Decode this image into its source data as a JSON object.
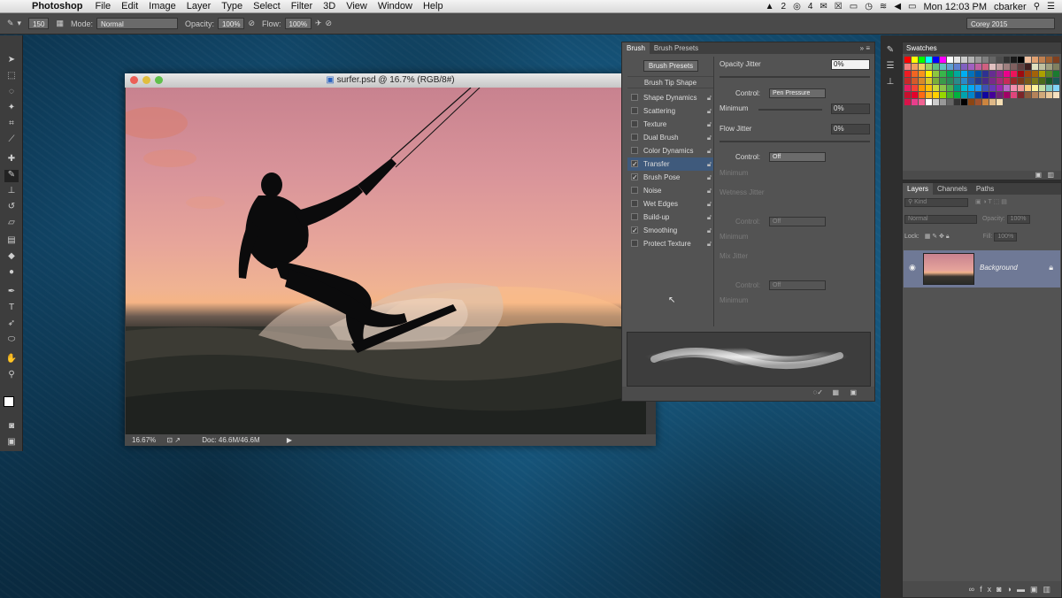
{
  "menubar": {
    "app_name": "Photoshop",
    "items": [
      "File",
      "Edit",
      "Image",
      "Layer",
      "Type",
      "Select",
      "Filter",
      "3D",
      "View",
      "Window",
      "Help"
    ],
    "status_icon_a": "2",
    "status_icon_b": "4",
    "clock": "Mon 12:03 PM",
    "user": "cbarker"
  },
  "options_bar": {
    "brush_size": "150",
    "mode_label": "Mode:",
    "mode_value": "Normal",
    "opacity_label": "Opacity:",
    "opacity_value": "100%",
    "flow_label": "Flow:",
    "flow_value": "100%",
    "workspace": "Corey 2015"
  },
  "document": {
    "title": "surfer.psd @ 16.7% (RGB/8#)",
    "zoom": "16.67%",
    "doc_size": "Doc: 46.6M/46.6M"
  },
  "brush_panel": {
    "tabs": [
      "Brush",
      "Brush Presets"
    ],
    "presets_button": "Brush Presets",
    "tip_shape": "Brush Tip Shape",
    "options": [
      {
        "label": "Shape Dynamics",
        "checked": false
      },
      {
        "label": "Scattering",
        "checked": false
      },
      {
        "label": "Texture",
        "checked": false
      },
      {
        "label": "Dual Brush",
        "checked": false
      },
      {
        "label": "Color Dynamics",
        "checked": false
      },
      {
        "label": "Transfer",
        "checked": true
      },
      {
        "label": "Brush Pose",
        "checked": true
      },
      {
        "label": "Noise",
        "checked": false
      },
      {
        "label": "Wet Edges",
        "checked": false
      },
      {
        "label": "Build-up",
        "checked": false
      },
      {
        "label": "Smoothing",
        "checked": true
      },
      {
        "label": "Protect Texture",
        "checked": false
      }
    ],
    "opacity_jitter_label": "Opacity Jitter",
    "opacity_jitter_value": "0%",
    "control_label": "Control:",
    "control_value_1": "Pen Pressure",
    "minimum_label": "Minimum",
    "minimum_value": "0%",
    "flow_jitter_label": "Flow Jitter",
    "flow_jitter_value": "0%",
    "control_value_2": "Off",
    "wetness_jitter_label": "Wetness Jitter",
    "control_value_3": "Off",
    "mix_jitter_label": "Mix Jitter",
    "control_value_4": "Off"
  },
  "swatches_panel": {
    "title": "Swatches"
  },
  "layers_panel": {
    "tabs": [
      "Layers",
      "Channels",
      "Paths"
    ],
    "filter": "Kind",
    "blend": "Normal",
    "opacity_label": "Opacity:",
    "opacity_value": "100%",
    "lock_label": "Lock:",
    "fill_label": "Fill:",
    "fill_value": "100%",
    "layer_name": "Background"
  }
}
